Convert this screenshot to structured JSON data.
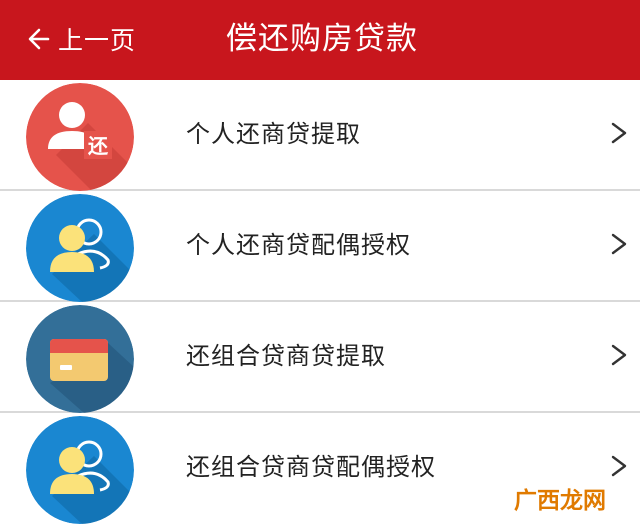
{
  "header": {
    "back_label": "上一页",
    "title": "偿还购房贷款",
    "background": "#c8161d"
  },
  "items": [
    {
      "label": "个人还商贷提取",
      "icon": "person-repay-icon",
      "icon_badge": "还",
      "icon_color": "#e5534b"
    },
    {
      "label": "个人还商贷配偶授权",
      "icon": "users-icon",
      "icon_color": "#1a87d1"
    },
    {
      "label": "还组合贷商贷提取",
      "icon": "card-icon",
      "icon_color": "#336f98"
    },
    {
      "label": "还组合贷商贷配偶授权",
      "icon": "users-icon",
      "icon_color": "#1a87d1"
    }
  ],
  "chevron_glyph": ">",
  "watermark": {
    "text": "广西龙网"
  }
}
